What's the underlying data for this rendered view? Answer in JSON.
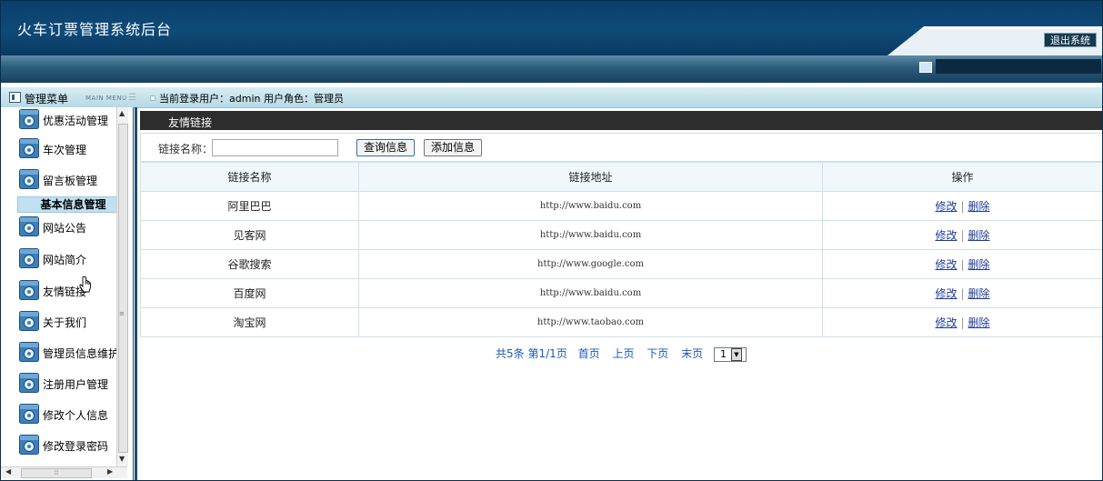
{
  "header": {
    "app_title": "火车订票管理系统后台",
    "logout_label": "退出系统"
  },
  "infobar": {
    "menu_title": "管理菜单",
    "menu_en": "MAIN MENU",
    "login_info": "当前登录用户：admin 用户角色：管理员"
  },
  "sidebar": {
    "items_top": [
      {
        "label": "优惠活动管理",
        "icon": "settings-icon"
      },
      {
        "label": "车次管理",
        "icon": "settings-icon"
      },
      {
        "label": "留言板管理",
        "icon": "settings-icon"
      }
    ],
    "section_title": "基本信息管理",
    "items_bottom": [
      {
        "label": "网站公告",
        "icon": "settings-icon"
      },
      {
        "label": "网站简介",
        "icon": "settings-icon"
      },
      {
        "label": "友情链接",
        "icon": "settings-icon"
      },
      {
        "label": "关于我们",
        "icon": "settings-icon"
      },
      {
        "label": "管理员信息维护",
        "icon": "settings-icon"
      },
      {
        "label": "注册用户管理",
        "icon": "settings-icon"
      },
      {
        "label": "修改个人信息",
        "icon": "settings-icon"
      },
      {
        "label": "修改登录密码",
        "icon": "settings-icon"
      }
    ]
  },
  "content": {
    "section_title": "友情链接",
    "search": {
      "label": "链接名称：",
      "value": "",
      "placeholder": ""
    },
    "buttons": {
      "query": "查询信息",
      "add": "添加信息"
    },
    "table": {
      "columns": [
        "链接名称",
        "链接地址",
        "操作"
      ],
      "rows": [
        {
          "name": "阿里巴巴",
          "url": "http://www.baidu.com"
        },
        {
          "name": "见客网",
          "url": "http://www.baidu.com"
        },
        {
          "name": "谷歌搜索",
          "url": "http://www.google.com"
        },
        {
          "name": "百度网",
          "url": "http://www.baidu.com"
        },
        {
          "name": "淘宝网",
          "url": "http://www.taobao.com"
        }
      ],
      "edit_label": "修改",
      "delete_label": "删除",
      "action_separator": "|"
    },
    "pager": {
      "summary": "共5条 第1/1页",
      "first": "首页",
      "prev": "上页",
      "next": "下页",
      "last": "末页",
      "current_page": "1"
    }
  },
  "colors": {
    "header_bg": "#0e4a78",
    "section_bar": "#2d2d2d",
    "link": "#1f3d99",
    "pager": "#1a58b8"
  }
}
